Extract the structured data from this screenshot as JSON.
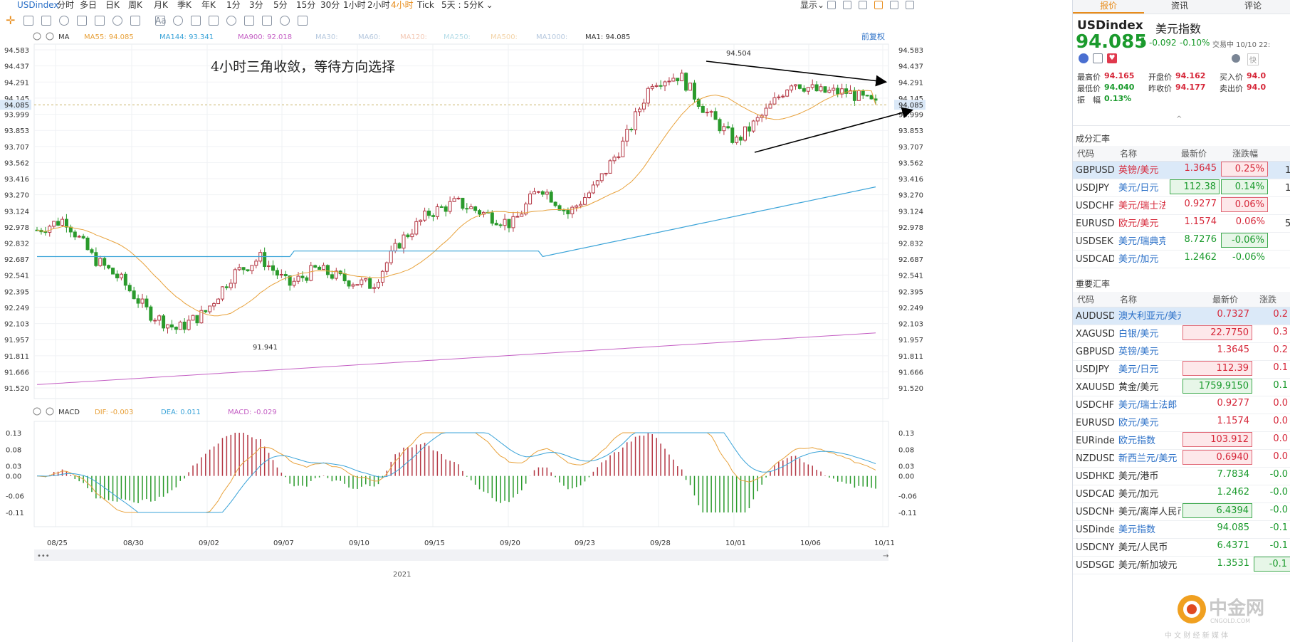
{
  "toolbar": {
    "symbol": "USDindex",
    "periods": [
      "分时",
      "多日",
      "日K",
      "周K",
      "月K",
      "季K",
      "年K",
      "1分",
      "3分",
      "5分",
      "15分",
      "30分",
      "1小时",
      "2小时",
      "4小时",
      "Tick",
      "5天 : 5分K ⌄"
    ],
    "active_period": "4小时",
    "display_label": "显示⌄",
    "drawing_tool_icons": [
      "crosshair-icon",
      "trend-line-tool-icon",
      "rect-tool-icon",
      "pattern-tool-icon",
      "fib-tool-icon",
      "measure-tool-icon",
      "arrow-tool-icon",
      "text-tool-icon",
      "comment-tool-icon",
      "ruler-icon",
      "lock-icon",
      "magnet-icon",
      "hide-icon",
      "eraser-icon",
      "trash-icon",
      "visibility-icon",
      "settings-icon"
    ],
    "text_tool_label": "Aa"
  },
  "ma_legend": {
    "name": "MA",
    "items": [
      {
        "label": "MA55: 94.085",
        "color": "#e8a23c"
      },
      {
        "label": "MA144: 93.341",
        "color": "#3aa3d8"
      },
      {
        "label": "MA900: 92.018",
        "color": "#c45fc4"
      },
      {
        "label": "MA30:",
        "color": "#b5c8de"
      },
      {
        "label": "MA60:",
        "color": "#b5c8de"
      },
      {
        "label": "MA120:",
        "color": "#f3c8b4"
      },
      {
        "label": "MA250:",
        "color": "#b5dde8"
      },
      {
        "label": "MA500:",
        "color": "#f3d4a8"
      },
      {
        "label": "MA1000:",
        "color": "#b5c8de"
      },
      {
        "label": "MA1: 94.085",
        "color": "#333333"
      }
    ],
    "fq_label": "前复权"
  },
  "annotation": "4小时三角收敛，等待方向选择",
  "price_axis": [
    "94.583",
    "94.437",
    "94.291",
    "94.145",
    "93.999",
    "93.853",
    "93.707",
    "93.562",
    "93.416",
    "93.270",
    "93.124",
    "92.978",
    "92.832",
    "92.687",
    "92.541",
    "92.395",
    "92.249",
    "92.103",
    "91.957",
    "91.811",
    "91.666",
    "91.520"
  ],
  "current_price": "94.085",
  "high_label": "94.504",
  "low_label": "91.941",
  "date_axis": [
    "08/25",
    "08/30",
    "09/02",
    "09/07",
    "09/10",
    "09/15",
    "09/20",
    "09/23",
    "09/28",
    "10/01",
    "10/06",
    "10/11"
  ],
  "year_label": "2021",
  "macd_legend": {
    "name": "MACD",
    "dif": "DIF: -0.003",
    "dea": "DEA: 0.011",
    "macd": "MACD: -0.029"
  },
  "macd_axis": [
    "0.13",
    "0.08",
    "0.03",
    "0.00",
    "-0.06",
    "-0.11"
  ],
  "chart_data": {
    "type": "candlestick",
    "title": "",
    "y_range": [
      91.52,
      94.583
    ],
    "close_points": [
      [
        "08/25",
        92.95
      ],
      [
        "08/27",
        93.05
      ],
      [
        "08/30",
        92.7
      ],
      [
        "09/01",
        92.5
      ],
      [
        "09/02",
        92.2
      ],
      [
        "09/03",
        92.05
      ],
      [
        "09/06",
        92.2
      ],
      [
        "09/07",
        92.55
      ],
      [
        "09/08",
        92.7
      ],
      [
        "09/10",
        92.45
      ],
      [
        "09/13",
        92.6
      ],
      [
        "09/14",
        92.5
      ],
      [
        "09/15",
        92.45
      ],
      [
        "09/16",
        92.85
      ],
      [
        "09/17",
        93.1
      ],
      [
        "09/20",
        93.2
      ],
      [
        "09/21",
        93.1
      ],
      [
        "09/22",
        93.0
      ],
      [
        "09/23",
        93.35
      ],
      [
        "09/24",
        93.1
      ],
      [
        "09/27",
        93.35
      ],
      [
        "09/28",
        93.75
      ],
      [
        "09/29",
        94.3
      ],
      [
        "09/30",
        94.35
      ],
      [
        "10/01",
        94.0
      ],
      [
        "10/04",
        93.75
      ],
      [
        "10/05",
        94.0
      ],
      [
        "10/06",
        94.3
      ],
      [
        "10/07",
        94.2
      ],
      [
        "10/08",
        94.2
      ],
      [
        "10/11",
        94.085
      ]
    ],
    "ma_series": [
      {
        "name": "MA55",
        "last": 94.085
      },
      {
        "name": "MA144",
        "last": 93.341
      },
      {
        "name": "MA900",
        "last": 92.018
      }
    ],
    "macd": {
      "dif": -0.003,
      "dea": 0.011,
      "macd": -0.029,
      "y_range": [
        -0.11,
        0.13
      ]
    }
  },
  "quote": {
    "symbol": "USDindex",
    "name": "美元指数",
    "price": "94.085",
    "arrow": "⬇",
    "change": "-0.092",
    "change_pct": "-0.10%",
    "status": "交易中 10/10 22:",
    "quick_label": "快",
    "fields": [
      {
        "k": "最高价",
        "v": "94.165"
      },
      {
        "k": "开盘价",
        "v": "94.162"
      },
      {
        "k": "买入价",
        "v": "94.0"
      },
      {
        "k": "最低价",
        "v": "94.040"
      },
      {
        "k": "昨收价",
        "v": "94.177"
      },
      {
        "k": "卖出价",
        "v": "94.0"
      },
      {
        "k": "振　幅",
        "v": "0.13%"
      }
    ],
    "collapse": "^"
  },
  "side_tabs": [
    "报价",
    "资讯",
    "评论"
  ],
  "components": {
    "title": "成分汇率",
    "headers": [
      "代码",
      "名称",
      "最新价",
      "涨跌幅"
    ],
    "rows": [
      {
        "code": "GBPUSD",
        "name": "英镑/美元",
        "price": "1.3645",
        "pct": "0.25%",
        "dir": "up",
        "box": "pct",
        "extra": "1"
      },
      {
        "code": "USDJPY",
        "name": "美元/日元",
        "price": "112.38",
        "pct": "0.14%",
        "dir": "dn",
        "box": "both",
        "extra": "1"
      },
      {
        "code": "USDCHF",
        "name": "美元/瑞士法",
        "price": "0.9277",
        "pct": "0.06%",
        "dir": "up",
        "box": "pct",
        "extra": ""
      },
      {
        "code": "EURUSD",
        "name": "欧元/美元",
        "price": "1.1574",
        "pct": "0.06%",
        "dir": "up",
        "box": "none",
        "extra": "5"
      },
      {
        "code": "USDSEK",
        "name": "美元/瑞典克",
        "price": "8.7276",
        "pct": "-0.06%",
        "dir": "dn",
        "box": "pct",
        "extra": ""
      },
      {
        "code": "USDCAD",
        "name": "美元/加元",
        "price": "1.2462",
        "pct": "-0.06%",
        "dir": "dn",
        "box": "none",
        "extra": ""
      }
    ]
  },
  "majors": {
    "title": "重要汇率",
    "headers": [
      "代码",
      "名称",
      "最新价",
      "涨跌"
    ],
    "rows": [
      {
        "code": "AUDUSD",
        "name": "澳大利亚元/美元",
        "price": "0.7327",
        "pct": "0.2",
        "dir": "up",
        "box": "none"
      },
      {
        "code": "XAGUSD",
        "name": "白银/美元",
        "price": "22.7750",
        "pct": "0.3",
        "dir": "up",
        "box": "price"
      },
      {
        "code": "GBPUSD",
        "name": "英镑/美元",
        "price": "1.3645",
        "pct": "0.2",
        "dir": "up",
        "box": "none"
      },
      {
        "code": "USDJPY",
        "name": "美元/日元",
        "price": "112.39",
        "pct": "0.1",
        "dir": "up",
        "box": "price"
      },
      {
        "code": "XAUUSD",
        "name": "黄金/美元",
        "price": "1759.9150",
        "pct": "0.1",
        "dir": "dn",
        "box": "price"
      },
      {
        "code": "USDCHF",
        "name": "美元/瑞士法郎",
        "price": "0.9277",
        "pct": "0.0",
        "dir": "up",
        "box": "none"
      },
      {
        "code": "EURUSD",
        "name": "欧元/美元",
        "price": "1.1574",
        "pct": "0.0",
        "dir": "up",
        "box": "none"
      },
      {
        "code": "EURindex",
        "name": "欧元指数",
        "price": "103.912",
        "pct": "0.0",
        "dir": "up",
        "box": "price"
      },
      {
        "code": "NZDUSD",
        "name": "新西兰元/美元",
        "price": "0.6940",
        "pct": "0.0",
        "dir": "up",
        "box": "price"
      },
      {
        "code": "USDHKD",
        "name": "美元/港币",
        "price": "7.7834",
        "pct": "-0.0",
        "dir": "dn",
        "box": "none"
      },
      {
        "code": "USDCAD",
        "name": "美元/加元",
        "price": "1.2462",
        "pct": "-0.0",
        "dir": "dn",
        "box": "none"
      },
      {
        "code": "USDCNH",
        "name": "美元/离岸人民币",
        "price": "6.4394",
        "pct": "-0.0",
        "dir": "dn",
        "box": "price"
      },
      {
        "code": "USDindex",
        "name": "美元指数",
        "price": "94.085",
        "pct": "-0.1",
        "dir": "dn",
        "box": "none"
      },
      {
        "code": "USDCNY",
        "name": "美元/人民币",
        "price": "6.4371",
        "pct": "-0.1",
        "dir": "dn",
        "box": "none"
      },
      {
        "code": "USDSGD",
        "name": "美元/新加坡元",
        "price": "1.3531",
        "pct": "-0.1",
        "dir": "dn",
        "box": "pct"
      }
    ]
  },
  "watermark": {
    "brand": "中金网",
    "domain": "CNGOLD.COM",
    "slogan": "中 文 财 经 新 媒 体"
  }
}
